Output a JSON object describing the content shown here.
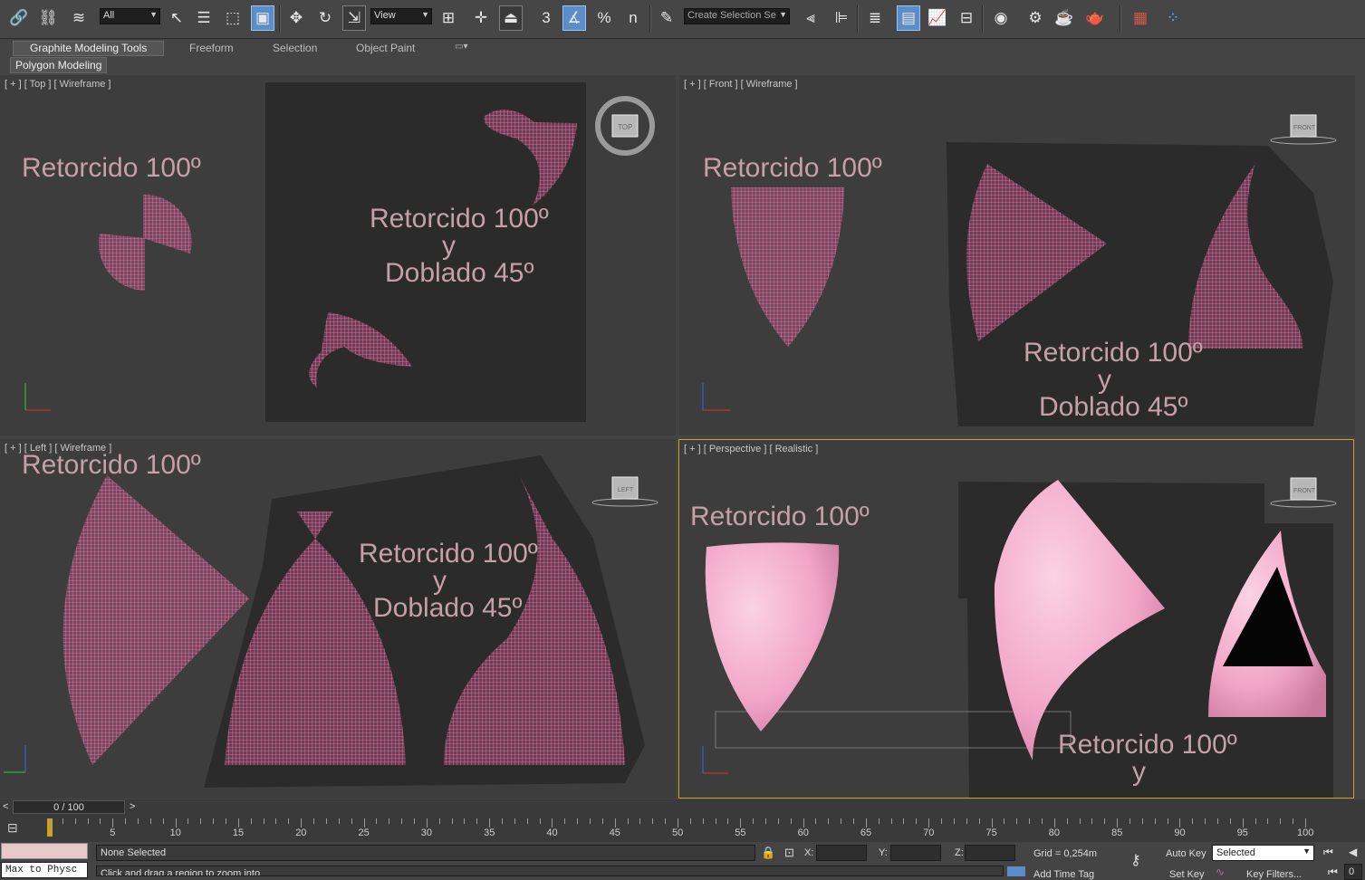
{
  "toolbar": {
    "selection_filter": "All",
    "ref_coord": "View",
    "named_selection_placeholder": "Create Selection Se",
    "snap_toggle_label": "3",
    "percent_snap_label": "%",
    "spinner_snap_label": "n"
  },
  "ribbon": {
    "tabs": [
      "Graphite Modeling Tools",
      "Freeform",
      "Selection",
      "Object Paint"
    ],
    "panel_label": "Polygon Modeling"
  },
  "viewports": {
    "top": {
      "label": "[ + ] [ Top ] [ Wireframe ]",
      "viewcube": "TOP"
    },
    "front": {
      "label": "[ + ] [ Front ] [ Wireframe ]",
      "viewcube": "FRONT"
    },
    "left": {
      "label": "[ + ] [ Left ] [ Wireframe ]",
      "viewcube": "LEFT"
    },
    "perspective": {
      "label": "[ + ] [ Perspective ] [ Realistic ]",
      "viewcube": "FRONT"
    }
  },
  "scene_text": {
    "line1": "Retorcido 100º",
    "line2": "y",
    "line3": "Doblado 45º"
  },
  "colors": {
    "mesh_wire": "#e45c9c",
    "mesh_shaded": "#f2a6c8",
    "viewport_bg": "#3d3d3d",
    "active_border": "#c9a227"
  },
  "time_slider": {
    "value": "0 / 100",
    "prev": "<",
    "next": ">"
  },
  "track": {
    "ticks": [
      "5",
      "10",
      "15",
      "20",
      "25",
      "30",
      "35",
      "40",
      "45",
      "50",
      "55",
      "60",
      "65",
      "70",
      "75",
      "80",
      "85",
      "90",
      "95",
      "100"
    ]
  },
  "status": {
    "maxscript": "Max to Physc",
    "selection": "None Selected",
    "prompt": "Click and drag a region to zoom into",
    "x_label": "X:",
    "y_label": "Y:",
    "z_label": "Z:",
    "grid": "Grid = 0,254m",
    "add_time_tag": "Add Time Tag",
    "auto_key": "Auto Key",
    "selected_dropdown": "Selected",
    "set_key": "Set Key",
    "key_filters": "Key Filters...",
    "frame": "0"
  }
}
